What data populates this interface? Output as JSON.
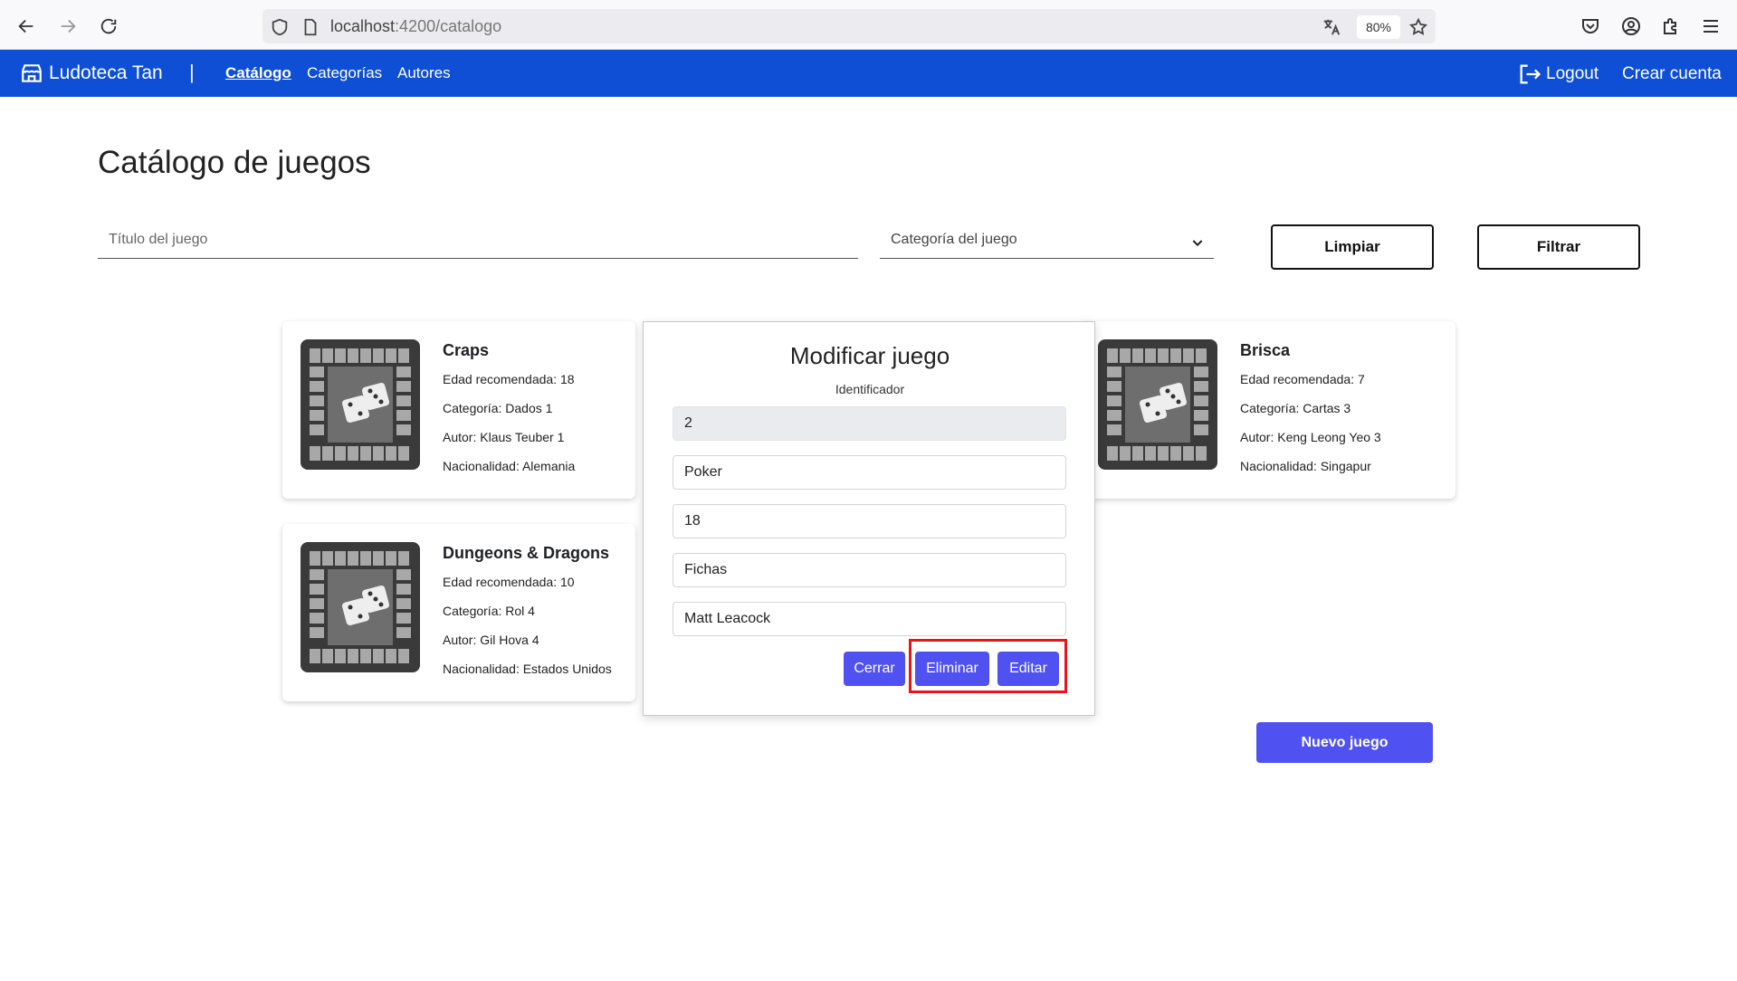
{
  "browser": {
    "url_host": "localhost",
    "url_path": ":4200/catalogo",
    "zoom": "80%"
  },
  "nav": {
    "brand": "Ludoteca Tan",
    "separator": "|",
    "links": [
      "Catálogo",
      "Categorías",
      "Autores"
    ],
    "logout": "Logout",
    "crear_cuenta": "Crear cuenta"
  },
  "page": {
    "title": "Catálogo de juegos",
    "filter_title_placeholder": "Título del juego",
    "filter_category_placeholder": "Categoría del juego",
    "clear_button": "Limpiar",
    "filter_button": "Filtrar",
    "new_game_button": "Nuevo juego"
  },
  "cards": [
    {
      "title": "Craps",
      "edad": "Edad recomendada: 18",
      "categoria": "Categoría: Dados 1",
      "autor": "Autor: Klaus Teuber 1",
      "nacionalidad": "Nacionalidad: Alemania"
    },
    {
      "title": "Brisca",
      "edad": "Edad recomendada: 7",
      "categoria": "Categoría: Cartas 3",
      "autor": "Autor: Keng Leong Yeo 3",
      "nacionalidad": "Nacionalidad: Singapur"
    },
    {
      "title": "Dungeons & Dragons",
      "edad": "Edad recomendada: 10",
      "categoria": "Categoría: Rol 4",
      "autor": "Autor: Gil Hova 4",
      "nacionalidad": "Nacionalidad: Estados Unidos"
    }
  ],
  "modal": {
    "title": "Modificar juego",
    "id_label": "Identificador",
    "fields": [
      "2",
      "Poker",
      "18",
      "Fichas",
      "Matt Leacock"
    ],
    "close_button": "Cerrar",
    "delete_button": "Eliminar",
    "edit_button": "Editar"
  },
  "colors": {
    "navbar": "#0e4fd6",
    "primary_button": "#4f52f0",
    "highlight": "#e8141c"
  }
}
